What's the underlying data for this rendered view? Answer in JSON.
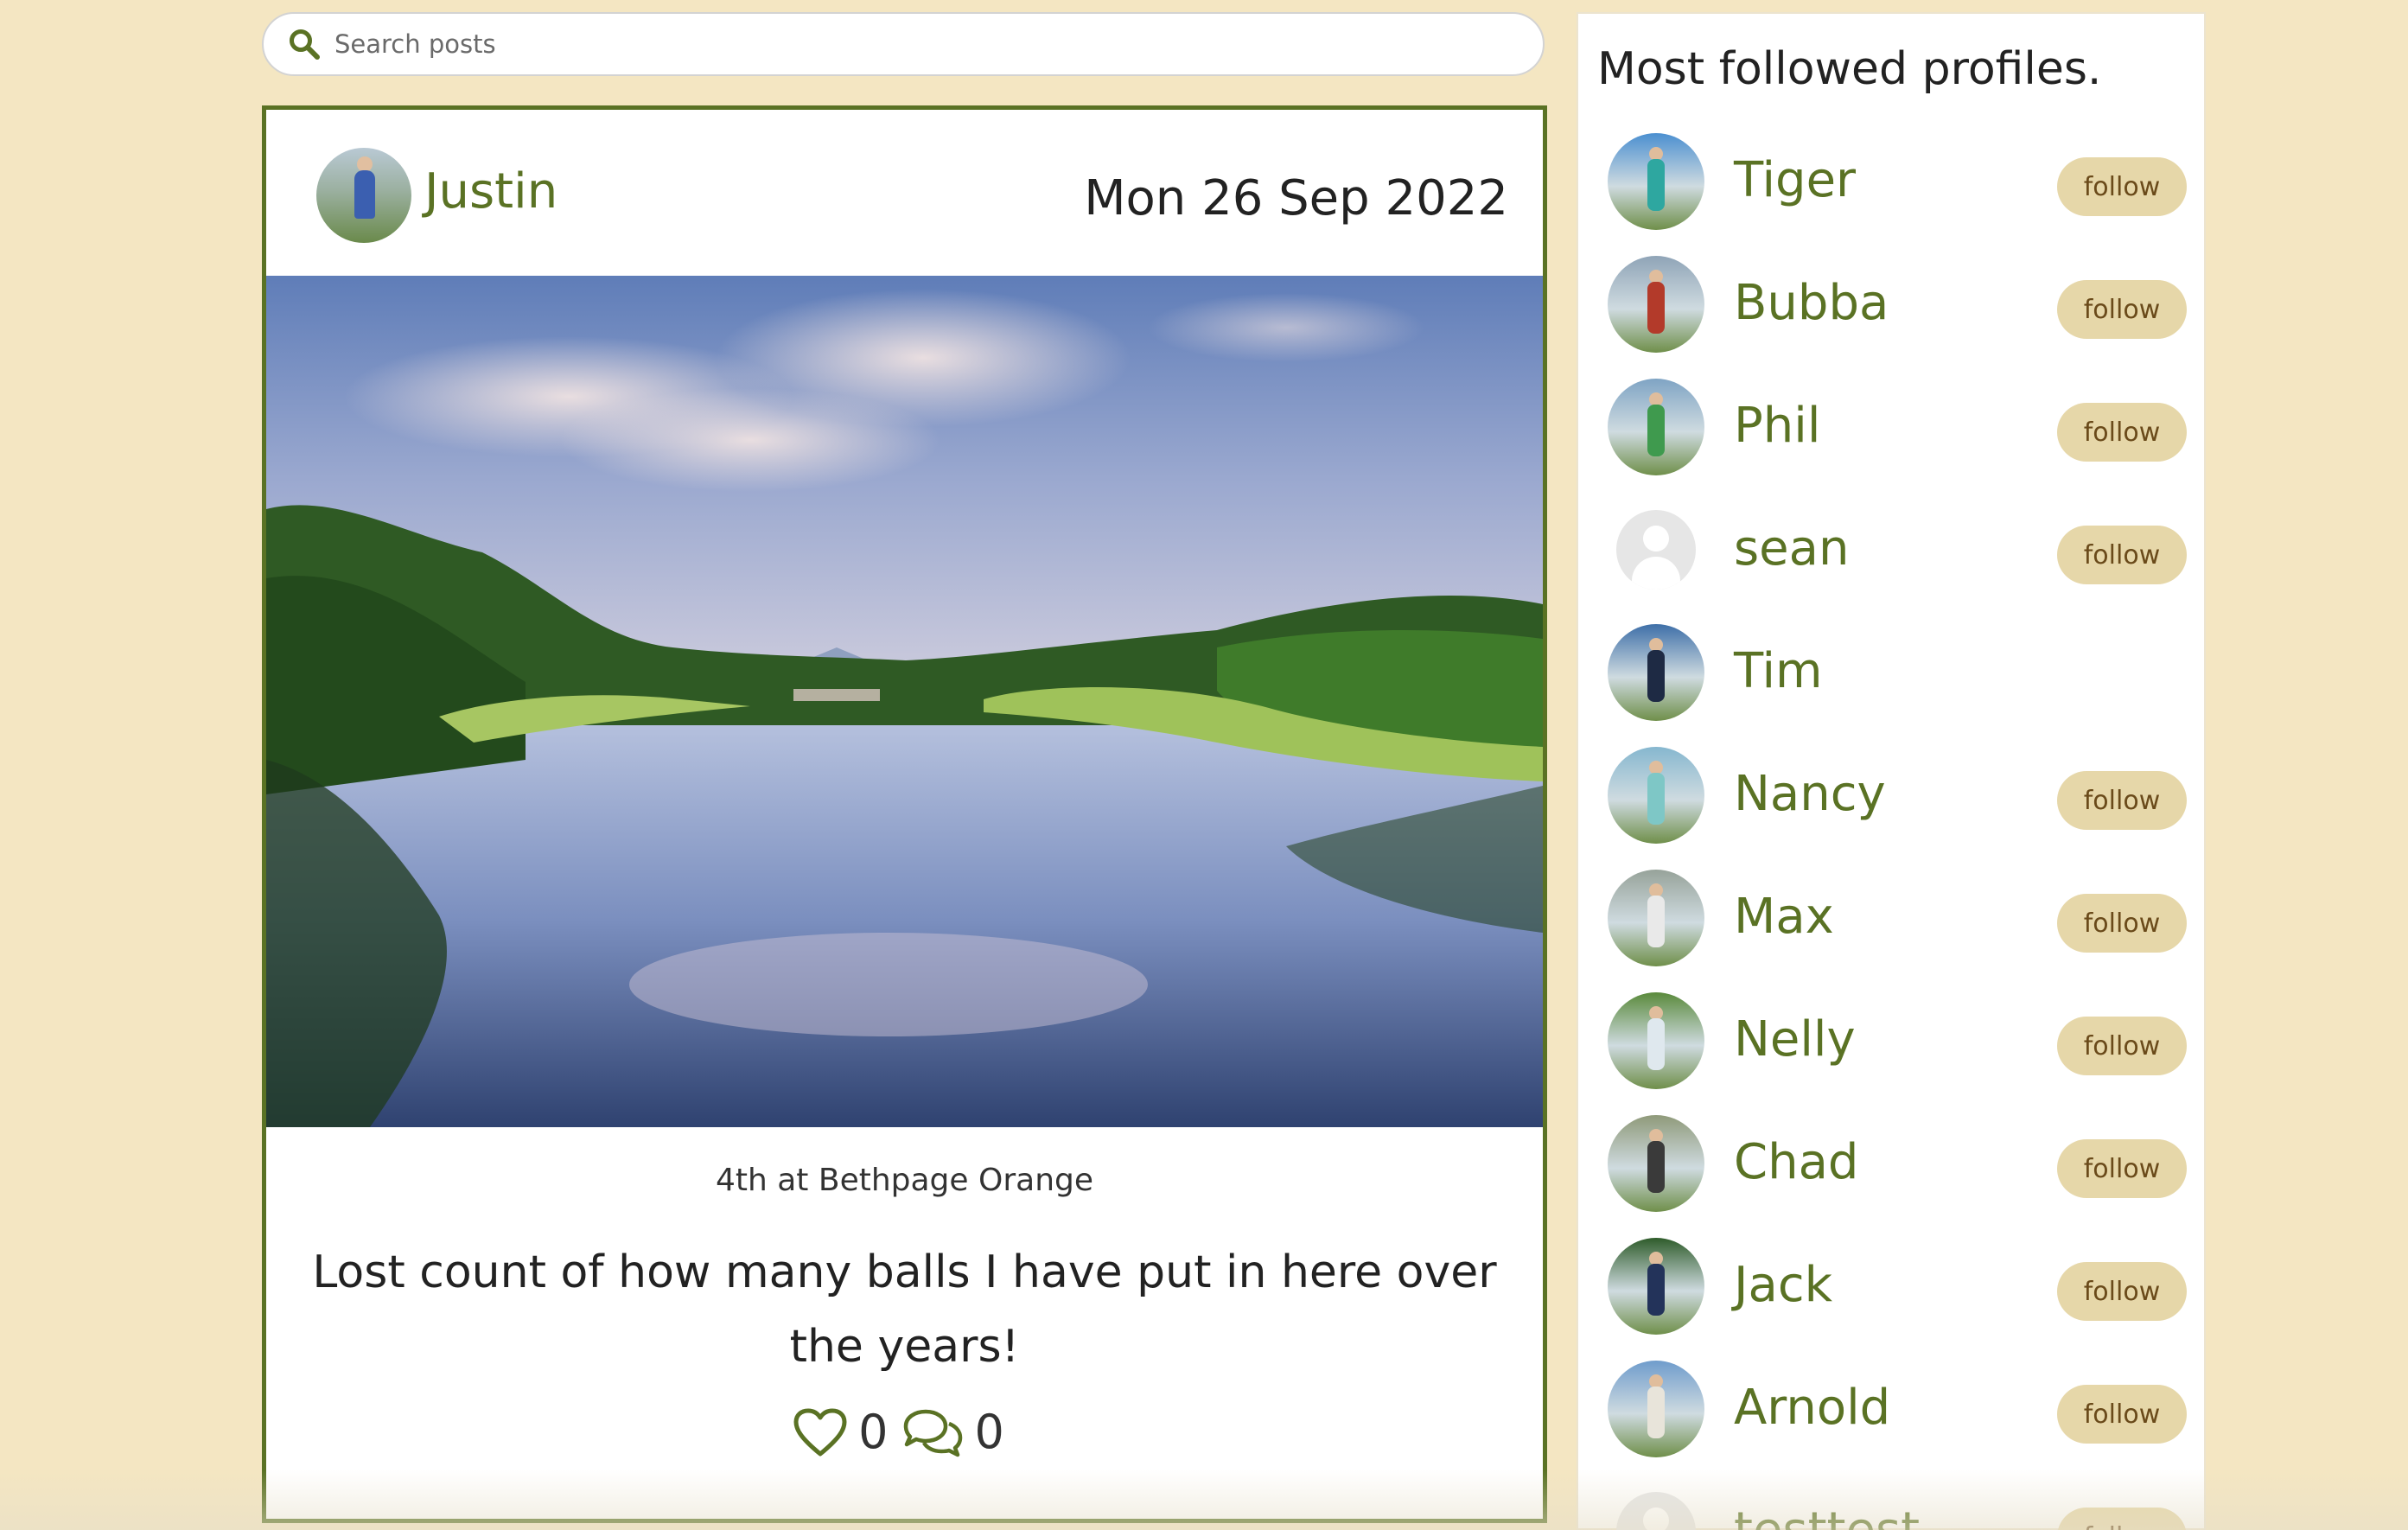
{
  "search": {
    "placeholder": "Search posts"
  },
  "post": {
    "author": "Justin",
    "date": "Mon 26 Sep 2022",
    "caption": "4th at Bethpage Orange",
    "body": "Lost count of how many balls I have put in here over the years!",
    "likes": "0",
    "comments": "0"
  },
  "sidebar": {
    "title": "Most followed profiles.",
    "profiles": [
      {
        "name": "Tiger",
        "follow": "follow",
        "avatar_bg": "#4b8fd0",
        "shirt": "#2ea7a0"
      },
      {
        "name": "Bubba",
        "follow": "follow",
        "avatar_bg": "#8fa4b7",
        "shirt": "#b33a2a"
      },
      {
        "name": "Phil",
        "follow": "follow",
        "avatar_bg": "#7fa4c4",
        "shirt": "#3f9a4e"
      },
      {
        "name": "sean",
        "follow": "follow",
        "avatar_bg": "#e6e6e6",
        "shirt": ""
      },
      {
        "name": "Tim",
        "follow": "",
        "avatar_bg": "#3e6fa8",
        "shirt": "#1e2a44"
      },
      {
        "name": "Nancy",
        "follow": "follow",
        "avatar_bg": "#86b7cf",
        "shirt": "#7ec7c6"
      },
      {
        "name": "Max",
        "follow": "follow",
        "avatar_bg": "#97a39a",
        "shirt": "#e9e9e9"
      },
      {
        "name": "Nelly",
        "follow": "follow",
        "avatar_bg": "#5a8a3c",
        "shirt": "#dfe8ee"
      },
      {
        "name": "Chad",
        "follow": "follow",
        "avatar_bg": "#8f9a7a",
        "shirt": "#3a3a3a"
      },
      {
        "name": "Jack",
        "follow": "follow",
        "avatar_bg": "#2f5c2b",
        "shirt": "#23335a"
      },
      {
        "name": "Arnold",
        "follow": "follow",
        "avatar_bg": "#6f9ccc",
        "shirt": "#e8e4da"
      },
      {
        "name": "testtest",
        "follow": "follow",
        "avatar_bg": "#e6e6e6",
        "shirt": ""
      }
    ]
  }
}
